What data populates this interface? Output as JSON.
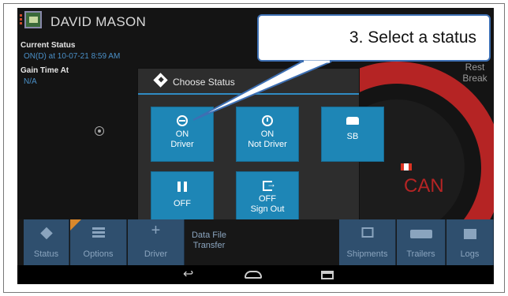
{
  "header": {
    "driver_name": "DAVID MASON"
  },
  "left_panel": {
    "current_status_label": "Current Status",
    "current_status_value": "ON(D) at 10-07-21 8:59 AM",
    "gain_time_label": "Gain Time At",
    "gain_time_value": "N/A"
  },
  "gauge": {
    "rest_break_line1": "Rest",
    "rest_break_line2": "Break",
    "region_text": "CAN"
  },
  "modal": {
    "title": "Choose Status",
    "buttons": [
      {
        "line1": "ON",
        "line2": "Driver",
        "icon": "steering-wheel-icon"
      },
      {
        "line1": "ON",
        "line2": "Not Driver",
        "icon": "clock-icon"
      },
      {
        "line1": "SB",
        "line2": "",
        "icon": "couch-icon"
      },
      {
        "line1": "OFF",
        "line2": "",
        "icon": "pause-icon"
      },
      {
        "line1": "OFF",
        "line2": "Sign Out",
        "icon": "sign-out-icon"
      }
    ]
  },
  "bottom_bar": {
    "status": "Status",
    "options": "Options",
    "driver": "Driver",
    "data_file_line1": "Data File",
    "data_file_line2": "Transfer",
    "shipments": "Shipments",
    "trailers": "Trailers",
    "logs": "Logs"
  },
  "callout": {
    "text": "3. Select a status"
  },
  "colors": {
    "accent_blue": "#1e86b6",
    "gauge_red": "#b52424",
    "bottom_button": "#2f4f6e",
    "callout_border": "#3d6fb3"
  }
}
